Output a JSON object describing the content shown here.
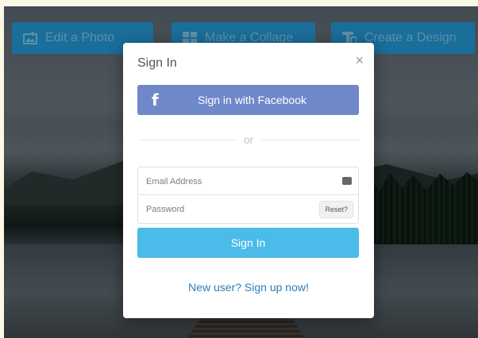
{
  "toolbar": {
    "edit_label": "Edit a Photo",
    "collage_label": "Make a Collage",
    "design_label": "Create a Design"
  },
  "modal": {
    "title": "Sign In",
    "close": "×",
    "facebook_icon": "f",
    "facebook_label": "Sign in with Facebook",
    "or": "or",
    "email_placeholder": "Email Address",
    "password_placeholder": "Password",
    "reset_label": "Reset?",
    "signin_label": "Sign In",
    "signup_label": "New user? Sign up now!"
  },
  "colors": {
    "facebook": "#6f88c9",
    "signin": "#4bbbe9",
    "link": "#2c7fb8",
    "toolbar_button": "#1a6e9a"
  }
}
